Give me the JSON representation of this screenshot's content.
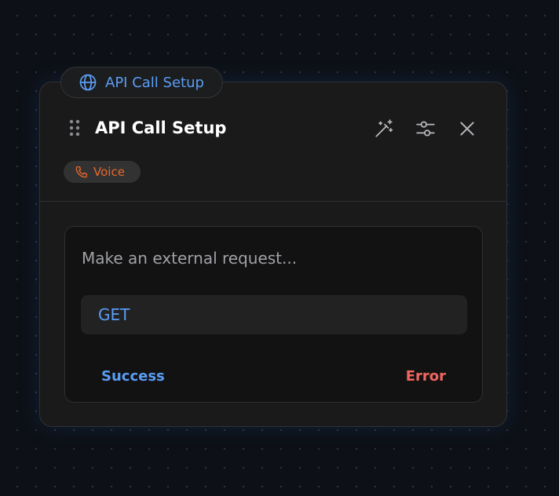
{
  "node": {
    "tab_label": "API Call Setup",
    "tab_icon": "globe-icon",
    "title": "API Call Setup",
    "header_actions": [
      {
        "name": "magic-wand-icon",
        "action": "ai-assist"
      },
      {
        "name": "sliders-icon",
        "action": "settings"
      },
      {
        "name": "close-icon",
        "action": "close"
      }
    ],
    "badge": {
      "label": "Voice",
      "icon": "phone-icon",
      "color": "#e8692a"
    },
    "description": "Make an external request...",
    "method": "GET",
    "outputs": {
      "success": "Success",
      "error": "Error"
    }
  },
  "colors": {
    "accent": "#5a9df4",
    "error": "#f0665f",
    "canvas": "#0d1016",
    "card": "#1a1a1b",
    "panel": "#121213"
  }
}
